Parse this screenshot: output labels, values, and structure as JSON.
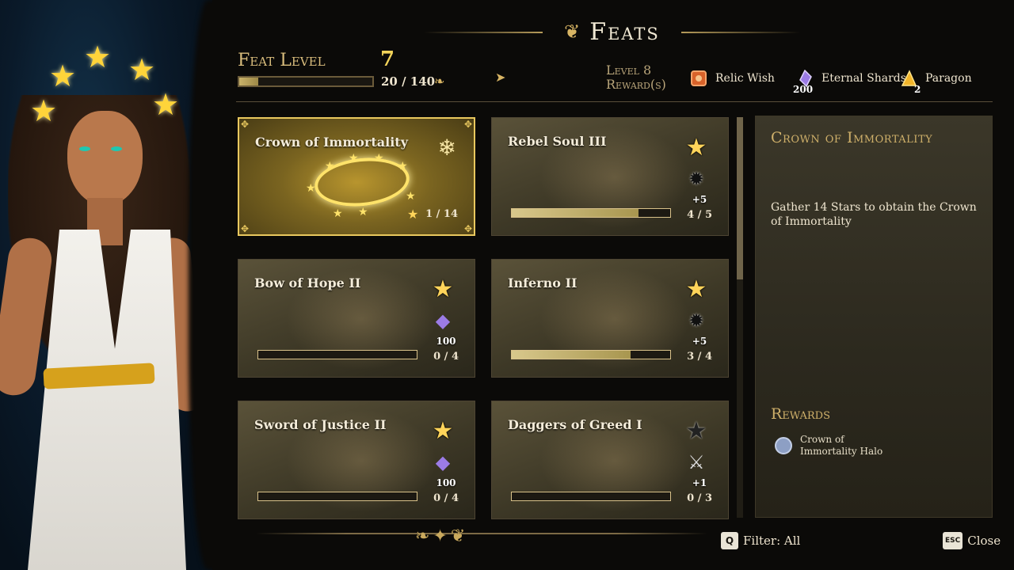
{
  "header": {
    "title": "Feats",
    "feat_level_label": "Feat Level",
    "feat_level_value": "7",
    "feat_progress_text": "20 / 140",
    "feat_progress_fraction": 0.143,
    "reward_label_line1": "Level 8",
    "reward_label_line2": "Reward(s)",
    "rewards": [
      {
        "icon": "relic-icon",
        "label": "Relic Wish",
        "qty": ""
      },
      {
        "icon": "eternal-shard-icon",
        "label": "Eternal Shards",
        "qty": "200"
      },
      {
        "icon": "paragon-icon",
        "label": "Paragon",
        "qty": "2"
      }
    ]
  },
  "feats": [
    {
      "title": "Crown of Immortality",
      "progress": "1 / 14",
      "fraction": 0.07,
      "reward_icon": "snowflake-icon",
      "reward_amount": "",
      "selected": true
    },
    {
      "title": "Rebel Soul III",
      "progress": "4 / 5",
      "fraction": 0.8,
      "reward_icon": "gear-icon",
      "reward_amount": "+5",
      "selected": false
    },
    {
      "title": "Bow of Hope II",
      "progress": "0 / 4",
      "fraction": 0.0,
      "reward_icon": "eternal-shard-icon",
      "reward_amount": "100",
      "selected": false
    },
    {
      "title": "Inferno II",
      "progress": "3 / 4",
      "fraction": 0.75,
      "reward_icon": "gear-icon",
      "reward_amount": "+5",
      "selected": false
    },
    {
      "title": "Sword of Justice II",
      "progress": "0 / 4",
      "fraction": 0.0,
      "reward_icon": "eternal-shard-icon",
      "reward_amount": "100",
      "selected": false
    },
    {
      "title": "Daggers of Greed I",
      "progress": "0 / 3",
      "fraction": 0.0,
      "reward_icon": "sword-icon",
      "reward_amount": "+1",
      "selected": false
    }
  ],
  "detail": {
    "title": "Crown of Immortality",
    "description": "Gather 14 Stars to obtain the Crown of Immortality",
    "rewards_title": "Rewards",
    "reward_item": "Crown of Immortality Halo"
  },
  "footer": {
    "filter_key": "Q",
    "filter_label": "Filter: All",
    "close_key": "ESC",
    "close_label": "Close"
  },
  "colors": {
    "accent_gold": "#e9c85e",
    "panel_bg": "#2c291e",
    "shard_purple": "#9b7be6"
  }
}
